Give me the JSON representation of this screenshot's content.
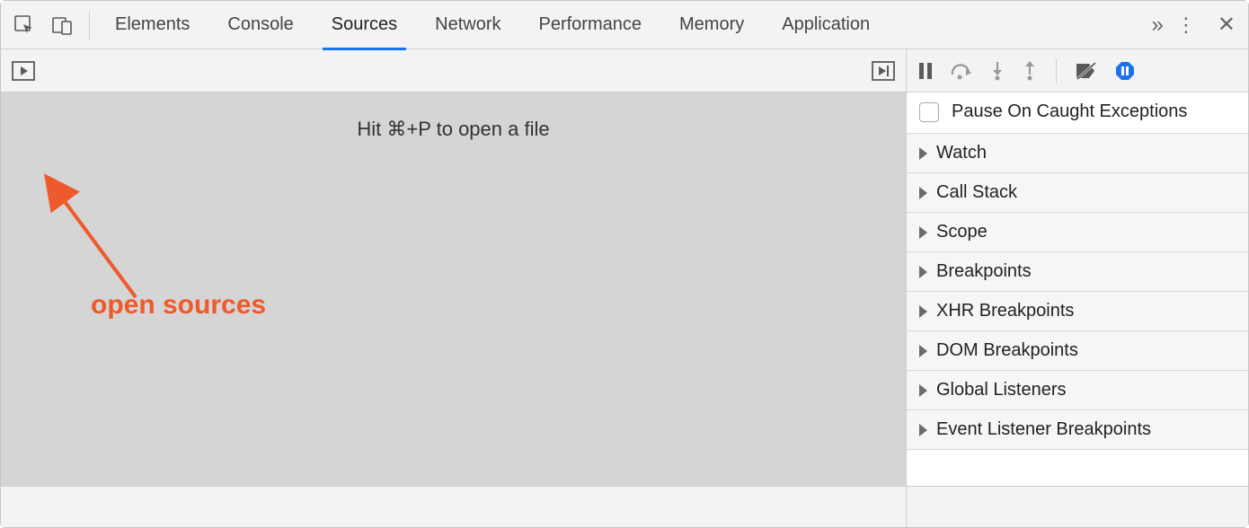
{
  "tabs": {
    "items": [
      "Elements",
      "Console",
      "Sources",
      "Network",
      "Performance",
      "Memory",
      "Application"
    ],
    "active_index": 2
  },
  "main": {
    "hint": "Hit ⌘+P to open a file"
  },
  "sidebar": {
    "pause_label": "Pause On Caught Exceptions",
    "sections": [
      "Watch",
      "Call Stack",
      "Scope",
      "Breakpoints",
      "XHR Breakpoints",
      "DOM Breakpoints",
      "Global Listeners",
      "Event Listener Breakpoints"
    ]
  },
  "annotation": {
    "label": "open sources"
  },
  "colors": {
    "accent": "#1a73e8",
    "annotation": "#ee5a2b"
  }
}
